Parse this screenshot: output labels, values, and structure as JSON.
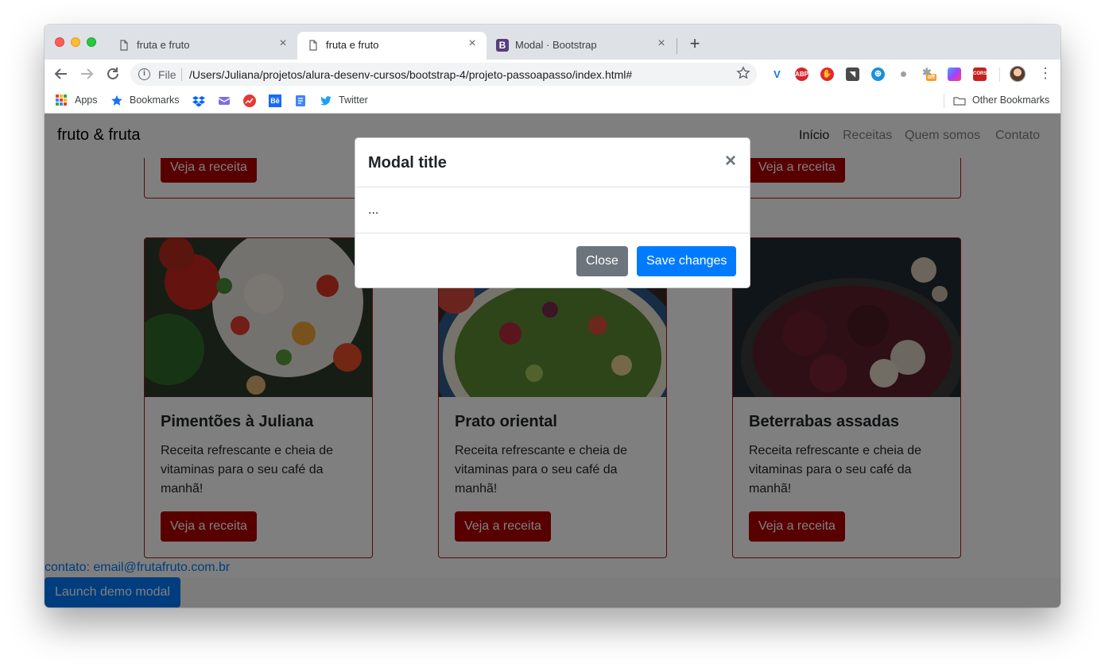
{
  "browser": {
    "tabs": [
      {
        "title": "fruta e fruto",
        "icon": "page-icon",
        "active": false
      },
      {
        "title": "fruta e fruto",
        "icon": "page-icon",
        "active": true
      },
      {
        "title": "Modal · Bootstrap",
        "icon": "bootstrap-icon",
        "icon_letter": "B",
        "active": false
      }
    ],
    "tab_close_glyph": "×",
    "new_tab_glyph": "+",
    "address": {
      "scheme_label": "File",
      "info_glyph": "i",
      "url": "/Users/Juliana/projetos/alura-desenv-cursos/bootstrap-4/projeto-passoapasso/index.html#"
    },
    "extensions": [
      {
        "name": "vivaldi-extension-icon",
        "label": "V",
        "color": "#1a73e8"
      },
      {
        "name": "adblock-plus-icon",
        "label": "ABP",
        "color": "#d7242a"
      },
      {
        "name": "adblock-hand-icon",
        "label": "✋",
        "color": "#e8262a"
      },
      {
        "name": "pocket-icon",
        "label": "◥",
        "color": "#4a4a4a"
      },
      {
        "name": "translate-extension-icon",
        "label": "⊕",
        "color": "#1a90d9"
      },
      {
        "name": "speech-bubble-icon",
        "label": "●",
        "color": "#9aa0a6"
      },
      {
        "name": "puzzle-off-icon",
        "label": "off",
        "color": "#f0a030"
      },
      {
        "name": "gradient-extension-icon",
        "label": "",
        "color": "#7b4dff"
      },
      {
        "name": "cors-icon",
        "label": "CORS",
        "color": "#c5221f"
      }
    ]
  },
  "bookmarks": {
    "items": [
      {
        "label": "Apps",
        "icon": "apps-grid-icon"
      },
      {
        "label": "Bookmarks",
        "icon": "star-icon"
      },
      {
        "label": "",
        "icon": "dropbox-icon"
      },
      {
        "label": "",
        "icon": "mail-icon"
      },
      {
        "label": "",
        "icon": "chart-icon"
      },
      {
        "label": "",
        "icon": "behance-icon",
        "glyph": "Bē"
      },
      {
        "label": "",
        "icon": "docs-icon"
      },
      {
        "label": "Twitter",
        "icon": "twitter-icon"
      }
    ],
    "other": "Other Bookmarks"
  },
  "page": {
    "brand": "fruto & fruta",
    "nav": [
      {
        "label": "Início",
        "active": true
      },
      {
        "label": "Receitas",
        "active": false
      },
      {
        "label": "Quem somos",
        "active": false
      },
      {
        "label": "Contato",
        "active": false
      }
    ],
    "top_buttons": [
      "Veja a receita",
      "Veja a receita"
    ],
    "cards": [
      {
        "title": "Pimentões à Juliana",
        "text": "Receita refrescante e cheia de vitaminas para o seu café da manhã!",
        "button": "Veja a receita",
        "image": "salad-peppers-photo"
      },
      {
        "title": "Prato oriental",
        "text": "Receita refrescante e cheia de vitaminas para o seu café da manhã!",
        "button": "Veja a receita",
        "image": "oriental-salad-photo"
      },
      {
        "title": "Beterrabas assadas",
        "text": "Receita refrescante e cheia de vitaminas para o seu café da manhã!",
        "button": "Veja a receita",
        "image": "roasted-beets-photo"
      }
    ],
    "contact": "contato: email@frutafruto.com.br",
    "launch_button": "Launch demo modal"
  },
  "modal": {
    "title": "Modal title",
    "close_glyph": "×",
    "body": "...",
    "close_button": "Close",
    "save_button": "Save changes"
  },
  "colors": {
    "accent_red": "#b00000",
    "primary_blue": "#007bff",
    "secondary_gray": "#6c757d"
  }
}
